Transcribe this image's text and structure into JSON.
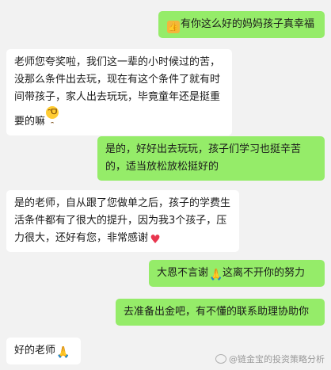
{
  "messages": [
    {
      "side": "me",
      "icon": "thumbs-up-emoji",
      "text": "有你这么好的妈妈孩子真幸福"
    },
    {
      "side": "them",
      "text": "老师您夸奖啦，我们这一辈的小时候过的苦，没那么条件出去玩，现在有这个条件了就有时间带孩子，家人出去玩玩，毕竟童年还是挺重要的嘛",
      "icon": "grin-emoji"
    },
    {
      "side": "me",
      "text": "是的，好好出去玩玩，孩子们学习也挺辛苦的，适当放松放松挺好的"
    },
    {
      "side": "them",
      "text": "是的老师，自从跟了您做单之后，孩子的学费生活条件都有了很大的提升，因为我3个孩子，压力很大，还好有您，非常感谢",
      "icon": "heart-emoji"
    },
    {
      "side": "me",
      "text_before": "大恩不言谢",
      "icon": "pray-emoji",
      "text_after": "这离不开你的努力"
    },
    {
      "side": "me",
      "text": "去准备出金吧，有不懂的联系助理协助你"
    },
    {
      "side": "them",
      "text": "好的老师",
      "icon": "pray-emoji"
    }
  ],
  "watermark": "@链金宝的投资策略分析"
}
